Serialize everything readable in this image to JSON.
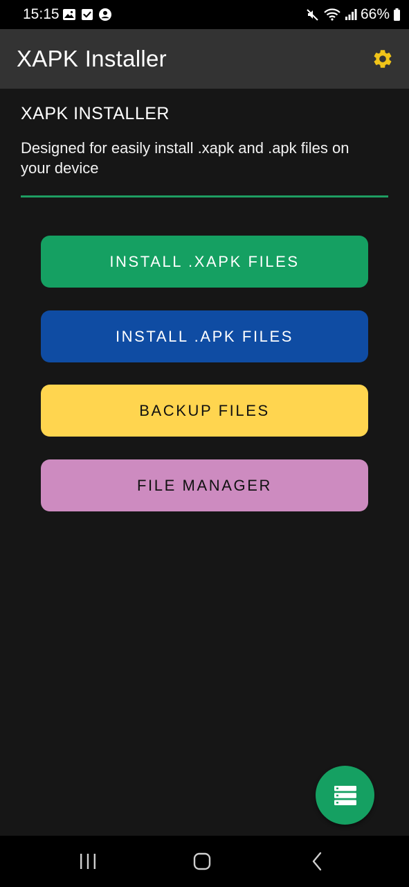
{
  "status_bar": {
    "time": "15:15",
    "battery": "66%",
    "left_icons": [
      "gallery-icon",
      "check-icon",
      "account-icon"
    ],
    "right_icons": [
      "mute-icon",
      "wifi-icon",
      "signal-icon",
      "battery-icon"
    ]
  },
  "app_bar": {
    "title": "XAPK Installer",
    "settings_icon": "gear-icon",
    "settings_color": "#f0c419"
  },
  "header": {
    "title": "XAPK INSTALLER",
    "description": "Designed for easily install .xapk and .apk files on your device",
    "divider_color": "#1e9e62"
  },
  "buttons": [
    {
      "label": "INSTALL .XAPK FILES",
      "bg": "#15a062",
      "fg": "#ffffff"
    },
    {
      "label": "INSTALL .APK FILES",
      "bg": "#0f4ca3",
      "fg": "#ffffff"
    },
    {
      "label": "BACKUP FILES",
      "bg": "#ffd54f",
      "fg": "#111111"
    },
    {
      "label": "FILE MANAGER",
      "bg": "#cd8bc0",
      "fg": "#111111"
    }
  ],
  "fab": {
    "icon": "list-icon",
    "bg": "#15a062"
  },
  "nav_bar": {
    "icons": [
      "recents-icon",
      "home-icon",
      "back-icon"
    ]
  },
  "theme": {
    "background": "#161616",
    "app_bar": "#333333"
  }
}
